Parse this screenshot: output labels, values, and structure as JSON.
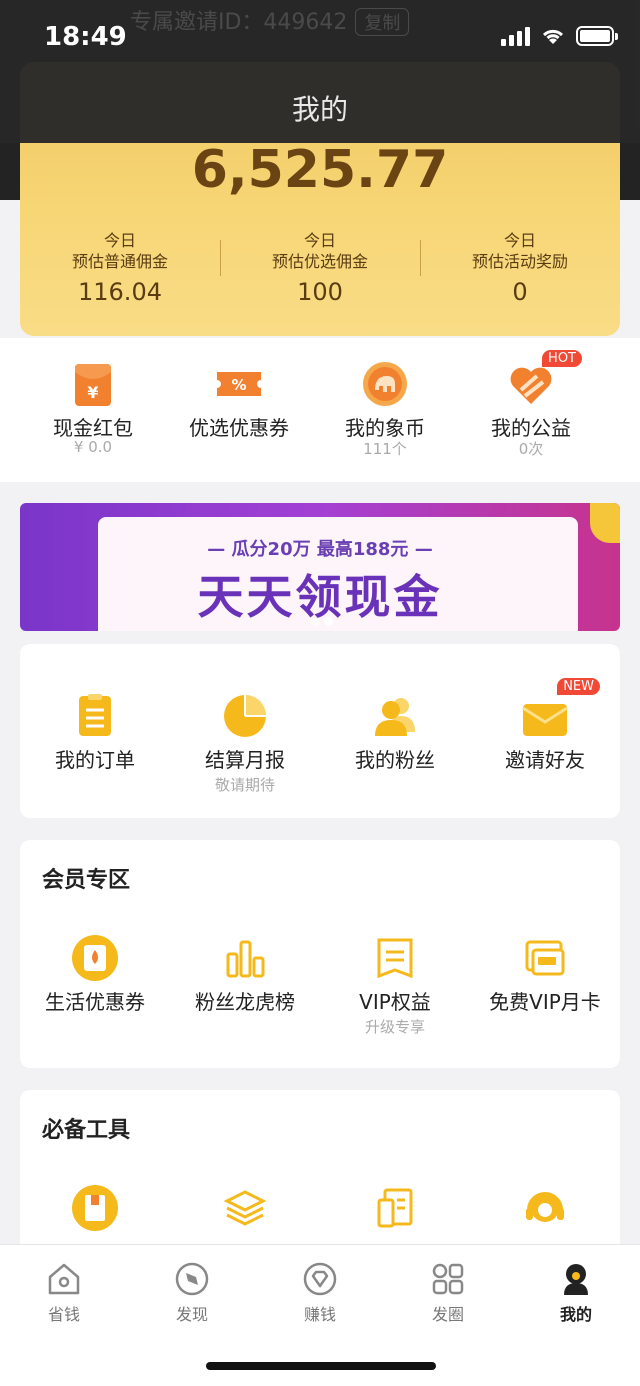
{
  "status": {
    "time": "18:49"
  },
  "header": {
    "title": "我的",
    "ghost_text": "专属邀请ID：449642",
    "ghost_copy": "复制"
  },
  "earnings": {
    "total": "6,525.77",
    "stats": [
      {
        "line1": "今日",
        "line2": "预估普通佣金",
        "value": "116.04"
      },
      {
        "line1": "今日",
        "line2": "预估优选佣金",
        "value": "100"
      },
      {
        "line1": "今日",
        "line2": "预估活动奖励",
        "value": "0"
      }
    ]
  },
  "quick": [
    {
      "label": "现金红包",
      "sub": "¥ 0.0",
      "icon": "red-envelope-icon"
    },
    {
      "label": "优选优惠券",
      "sub": "",
      "icon": "coupon-icon"
    },
    {
      "label": "我的象币",
      "sub": "111个",
      "icon": "elephant-coin-icon"
    },
    {
      "label": "我的公益",
      "sub": "0次",
      "icon": "heart-icon",
      "badge": "HOT"
    }
  ],
  "banner": {
    "sub": "— 瓜分20万  最高188元 —",
    "main": "天天领现金"
  },
  "features": [
    {
      "label": "我的订单",
      "sub": "",
      "icon": "order-list-icon"
    },
    {
      "label": "结算月报",
      "sub": "敬请期待",
      "icon": "pie-chart-icon"
    },
    {
      "label": "我的粉丝",
      "sub": "",
      "icon": "fans-icon"
    },
    {
      "label": "邀请好友",
      "sub": "",
      "icon": "invite-envelope-icon",
      "badge": "NEW"
    }
  ],
  "member": {
    "title": "会员专区",
    "items": [
      {
        "label": "生活优惠券",
        "sub": "",
        "icon": "life-coupon-icon"
      },
      {
        "label": "粉丝龙虎榜",
        "sub": "",
        "icon": "bar-chart-icon"
      },
      {
        "label": "VIP权益",
        "sub": "升级专享",
        "icon": "vip-rights-icon"
      },
      {
        "label": "免费VIP月卡",
        "sub": "",
        "icon": "vip-card-icon"
      }
    ]
  },
  "tools": {
    "title": "必备工具",
    "items": [
      {
        "icon": "book-icon"
      },
      {
        "icon": "layers-icon"
      },
      {
        "icon": "document-icon"
      },
      {
        "icon": "headset-icon"
      }
    ]
  },
  "tabs": [
    {
      "label": "省钱",
      "icon": "home-icon"
    },
    {
      "label": "发现",
      "icon": "compass-icon"
    },
    {
      "label": "赚钱",
      "icon": "diamond-icon"
    },
    {
      "label": "发圈",
      "icon": "grid-icon"
    },
    {
      "label": "我的",
      "icon": "profile-icon",
      "active": true
    }
  ],
  "colors": {
    "gold": "#f7d676",
    "accent": "#f5b91c",
    "orange": "#f2812f",
    "badge_red": "#f04a37"
  }
}
